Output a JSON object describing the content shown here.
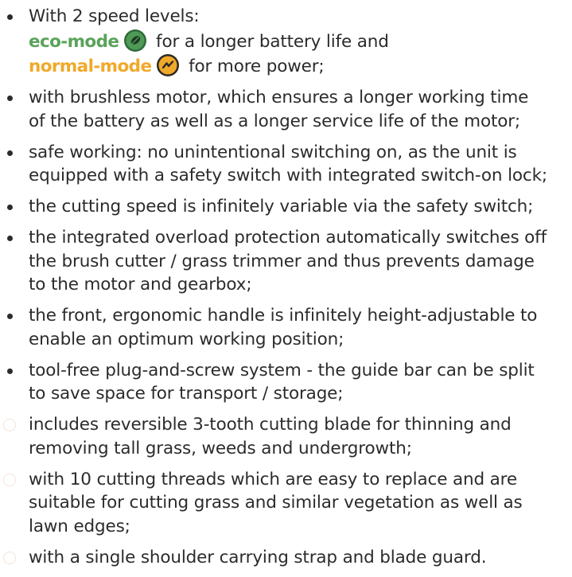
{
  "features": {
    "item1": {
      "line1": "With 2 speed levels:",
      "eco_label": "eco-mode",
      "eco_rest": " for a longer battery life and",
      "normal_label": "normal-mode",
      "normal_rest": " for more power;",
      "eco_icon": "leaf-icon",
      "normal_icon": "lightning-icon",
      "eco_color": "#5aa35a",
      "normal_color": "#f0a92a"
    },
    "items": [
      [
        "with brushless motor, which ensures a longer working time",
        "of the battery as well as a longer service life of the motor;"
      ],
      [
        "safe working: no unintentional switching on, as the unit is",
        "equipped with a safety switch with integrated switch-on lock;"
      ],
      [
        "the cutting speed is infinitely variable via the safety switch;"
      ],
      [
        "the integrated overload protection automatically switches off",
        "the brush cutter / grass trimmer and thus prevents damage",
        "to the motor and gearbox;"
      ],
      [
        "the front, ergonomic handle is infinitely height-adjustable to",
        "enable an optimum working position;"
      ],
      [
        "tool-free plug-and-screw system - the guide bar can be split",
        "to save space for transport / storage;"
      ],
      [
        "includes reversible 3-tooth cutting blade for thinning and",
        "removing tall grass, weeds and undergrowth;"
      ],
      [
        "with 10 cutting threads which are easy to replace and are",
        "suitable for cutting grass and similar vegetation as well as",
        "lawn edges;"
      ],
      [
        "with a single shoulder carrying strap and blade guard."
      ]
    ]
  }
}
